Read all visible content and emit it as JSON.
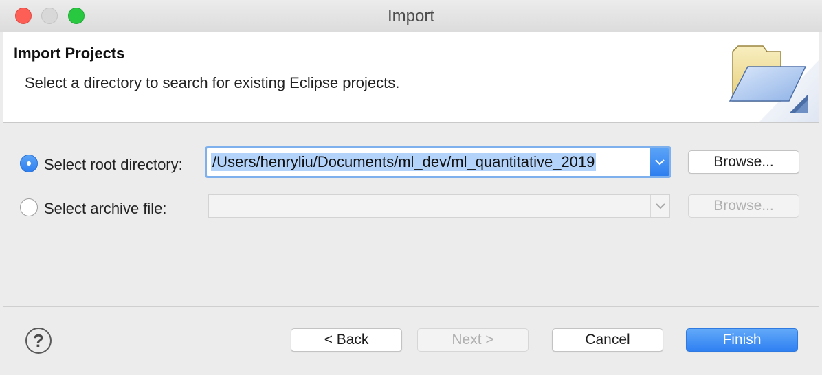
{
  "window": {
    "title": "Import"
  },
  "header": {
    "title": "Import Projects",
    "description": "Select a directory to search for existing Eclipse projects.",
    "icon": "folder-import-icon"
  },
  "form": {
    "root_directory": {
      "label": "Select root directory:",
      "selected": true,
      "value": "/Users/henryliu/Documents/ml_dev/ml_quantitative_2019",
      "browse_label": "Browse..."
    },
    "archive_file": {
      "label": "Select archive file:",
      "selected": false,
      "value": "",
      "browse_label": "Browse..."
    }
  },
  "footer": {
    "help_symbol": "?",
    "back_label": "< Back",
    "next_label": "Next >",
    "cancel_label": "Cancel",
    "finish_label": "Finish"
  },
  "colors": {
    "accent": "#2f80f2",
    "selection": "#b3d3fa",
    "close": "#fd5f57",
    "maximize": "#29c841"
  }
}
